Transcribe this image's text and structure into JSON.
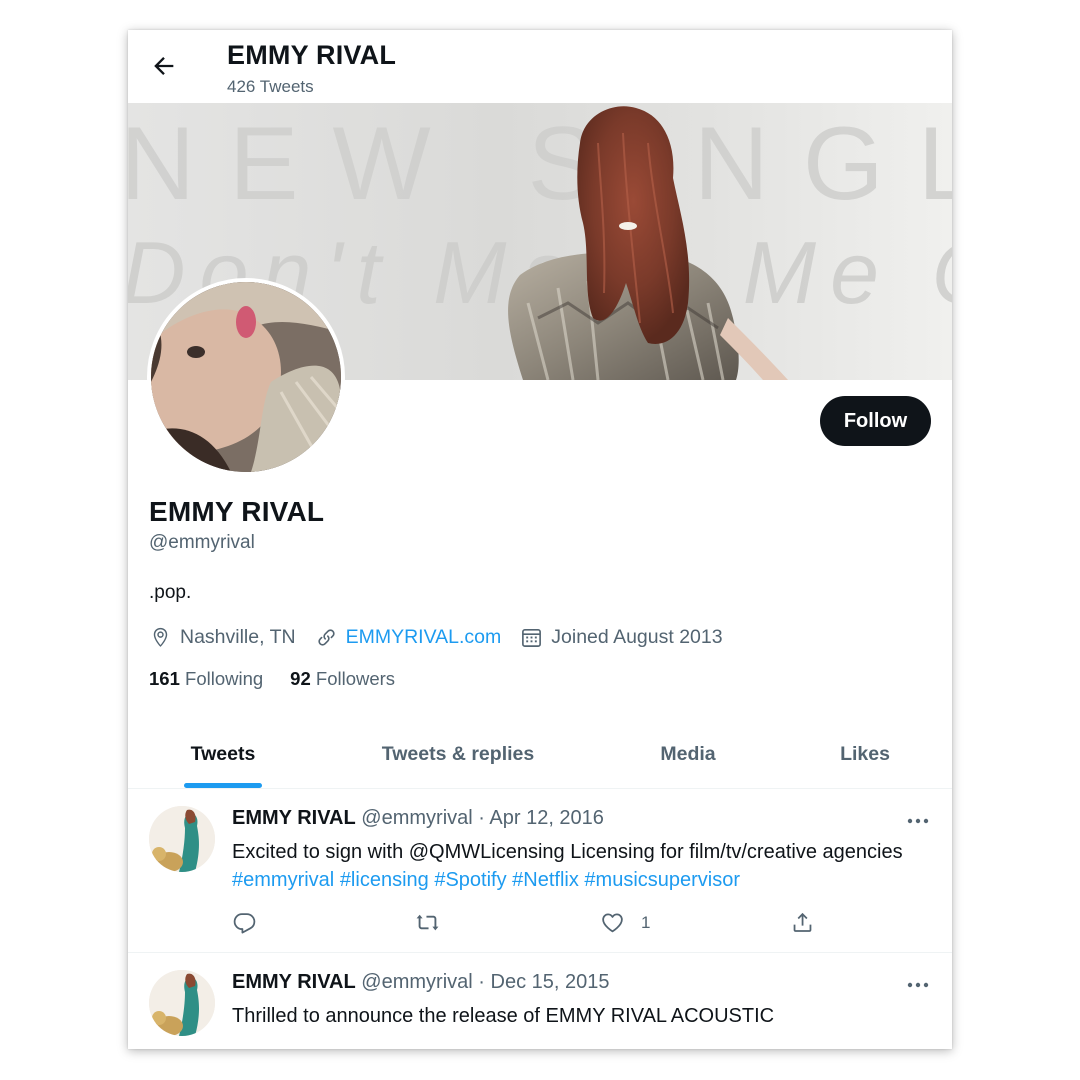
{
  "header": {
    "name": "EMMY RIVAL",
    "tweet_count": "426 Tweets",
    "back_icon": "arrow-left-icon"
  },
  "banner": {
    "line1": "NEW SINGLE",
    "line2": "Don't Make Me Cry"
  },
  "profile": {
    "name": "EMMY RIVAL",
    "handle": "@emmyrival",
    "bio": ".pop.",
    "location": "Nashville, TN",
    "website": "EMMYRIVAL.com",
    "joined": "Joined August 2013",
    "following_count": "161",
    "following_label": "Following",
    "followers_count": "92",
    "followers_label": "Followers",
    "follow_button": "Follow"
  },
  "tabs": [
    {
      "label": "Tweets",
      "active": true
    },
    {
      "label": "Tweets & replies",
      "active": false
    },
    {
      "label": "Media",
      "active": false
    },
    {
      "label": "Likes",
      "active": false
    }
  ],
  "tweets": [
    {
      "name": "EMMY RIVAL",
      "handle": "@emmyrival",
      "date": "Apr 12, 2016",
      "text": "Excited to sign with @QMWLicensing Licensing for film/tv/creative agencies",
      "hashtags": [
        "#emmyrival",
        "#licensing",
        "#Spotify",
        "#Netflix",
        "#musicsupervisor"
      ],
      "like_count": "1"
    },
    {
      "name": "EMMY RIVAL",
      "handle": "@emmyrival",
      "date": "Dec 15, 2015",
      "text": "Thrilled to announce the release of EMMY RIVAL ACOUSTIC"
    }
  ],
  "colors": {
    "accent": "#1d9bf0",
    "text_primary": "#0f1419",
    "text_secondary": "#536471",
    "follow_button_bg": "#0f1419"
  }
}
